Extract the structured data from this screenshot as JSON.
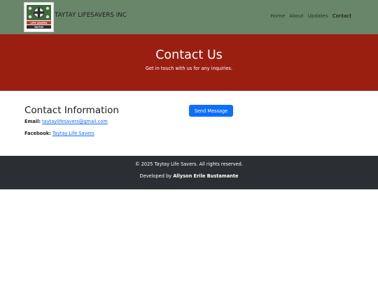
{
  "nav": {
    "brand": "TAYTAY LIFESAVERS INC",
    "logo_text_top": "LIFE SAVERS",
    "logo_text_bottom": "TAYTAY",
    "links": [
      "Home",
      "About",
      "Updates",
      "Contact"
    ],
    "active": "Contact"
  },
  "hero": {
    "title": "Contact Us",
    "subtitle": "Get in touch with us for any inquiries."
  },
  "contact": {
    "heading": "Contact Information",
    "email_label": "Email:",
    "email_value": "taytaylifesavers@gmail.com",
    "facebook_label": "Facebook:",
    "facebook_value": "Taytay Life Savers",
    "button_label": "Send Message"
  },
  "footer": {
    "copyright": "© 2025 Taytay Life Savers. All rights reserved.",
    "developed_by_label": "Developed by",
    "developer": "Allyson Erile Bustamante"
  },
  "colors": {
    "navbar": "#6a866a",
    "hero": "#9b1f11",
    "button": "#0d6efd",
    "footer": "#2b2f33"
  }
}
